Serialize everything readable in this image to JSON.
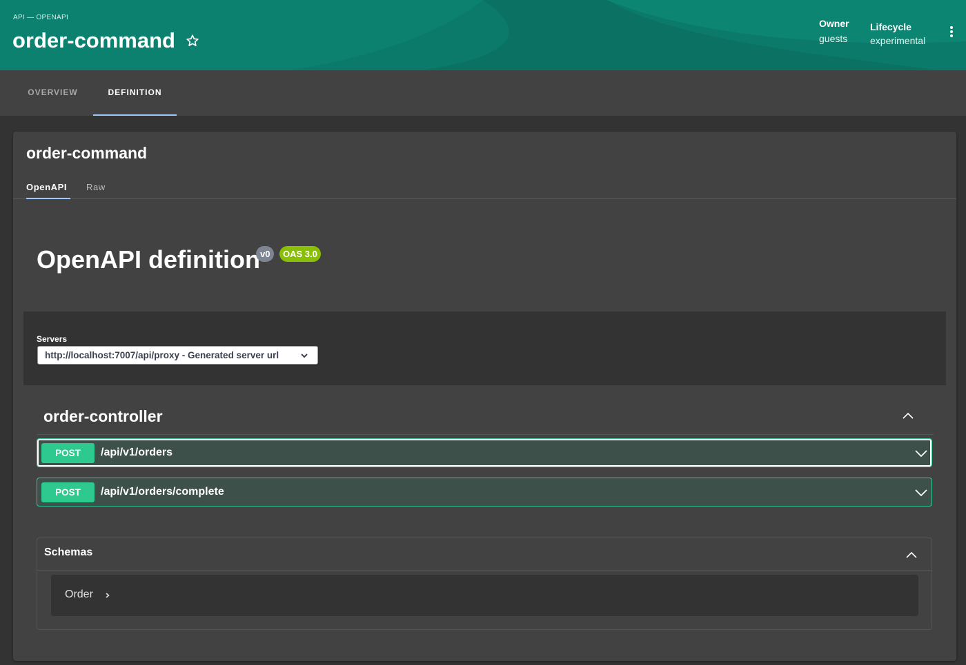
{
  "header": {
    "kind": "API — OPENAPI",
    "title": "order-command",
    "owner_label": "Owner",
    "owner_value": "guests",
    "lifecycle_label": "Lifecycle",
    "lifecycle_value": "experimental",
    "star_icon": "star-outline-icon",
    "menu_icon": "kebab-menu-icon"
  },
  "tabs": [
    {
      "label": "OVERVIEW",
      "selected": false
    },
    {
      "label": "DEFINITION",
      "selected": true
    }
  ],
  "card": {
    "title": "order-command",
    "subtabs": [
      {
        "label": "OpenAPI",
        "selected": true
      },
      {
        "label": "Raw",
        "selected": false
      }
    ]
  },
  "spec": {
    "title": "OpenAPI definition",
    "version_badge": "v0",
    "oas_badge": "OAS 3.0",
    "servers_label": "Servers",
    "server_selected": "http://localhost:7007/api/proxy - Generated server url"
  },
  "controller": {
    "name": "order-controller",
    "operations": [
      {
        "method": "POST",
        "path": "/api/v1/orders"
      },
      {
        "method": "POST",
        "path": "/api/v1/orders/complete"
      }
    ]
  },
  "schemas": {
    "title": "Schemas",
    "models": [
      {
        "name": "Order"
      }
    ]
  },
  "colors": {
    "header_bg": "#0b7a6b",
    "tab_indicator": "#9cc9ff",
    "post_method": "#2ec98e",
    "post_border": "#3ac99d",
    "oas_badge": "#89bf04",
    "version_badge": "#7d8492"
  }
}
